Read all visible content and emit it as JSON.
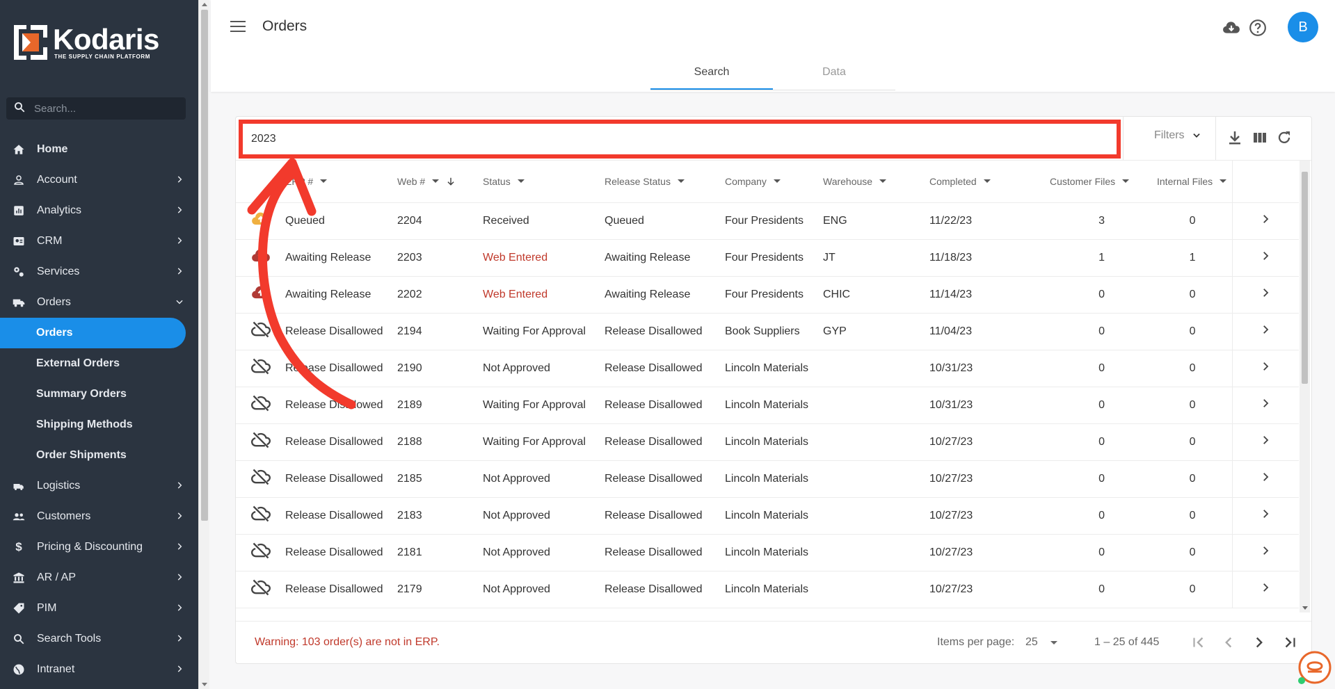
{
  "sidebar": {
    "logo": {
      "name": "Kodaris",
      "tagline": "THE SUPPLY CHAIN PLATFORM"
    },
    "search_placeholder": "Search...",
    "items": [
      {
        "label": "Home",
        "icon": "home-icon",
        "expandable": false
      },
      {
        "label": "Account",
        "icon": "person-icon",
        "expandable": true
      },
      {
        "label": "Analytics",
        "icon": "analytics-icon",
        "expandable": true
      },
      {
        "label": "CRM",
        "icon": "contact-card-icon",
        "expandable": true
      },
      {
        "label": "Services",
        "icon": "services-icon",
        "expandable": true
      },
      {
        "label": "Orders",
        "icon": "truck-icon",
        "expandable": true,
        "expanded": true
      },
      {
        "label": "Logistics",
        "icon": "shipping-icon",
        "expandable": true
      },
      {
        "label": "Customers",
        "icon": "group-icon",
        "expandable": true
      },
      {
        "label": "Pricing & Discounting",
        "icon": "dollar-icon",
        "expandable": true
      },
      {
        "label": "AR / AP",
        "icon": "bank-icon",
        "expandable": true
      },
      {
        "label": "PIM",
        "icon": "tag-icon",
        "expandable": true
      },
      {
        "label": "Search Tools",
        "icon": "search-icon",
        "expandable": true
      },
      {
        "label": "Intranet",
        "icon": "globe-icon",
        "expandable": true
      }
    ],
    "orders_subitems": [
      {
        "label": "Orders",
        "active": true
      },
      {
        "label": "External Orders",
        "active": false
      },
      {
        "label": "Summary Orders",
        "active": false
      },
      {
        "label": "Shipping Methods",
        "active": false
      },
      {
        "label": "Order Shipments",
        "active": false
      }
    ]
  },
  "header": {
    "title": "Orders",
    "avatar_initial": "B",
    "tabs": [
      {
        "label": "Search",
        "active": true
      },
      {
        "label": "Data",
        "active": false
      }
    ]
  },
  "toolbar": {
    "search_value": "2023",
    "filters_label": "Filters"
  },
  "table": {
    "columns": [
      "ERP #",
      "Web #",
      "Status",
      "Release Status",
      "Company",
      "Warehouse",
      "Completed",
      "Customer Files",
      "Internal Files"
    ],
    "rows": [
      {
        "icon": "cloud-upload-icon",
        "icon_color": "#f0b040",
        "erp": "Queued",
        "web": "2204",
        "status": "Received",
        "status_red": false,
        "release": "Queued",
        "company": "Four Presidents",
        "warehouse": "ENG",
        "completed": "11/22/23",
        "cust_files": "3",
        "int_files": "0"
      },
      {
        "icon": "cloud-upload-icon",
        "icon_color": "#b03a35",
        "erp": "Awaiting Release",
        "web": "2203",
        "status": "Web Entered",
        "status_red": true,
        "release": "Awaiting Release",
        "company": "Four Presidents",
        "warehouse": "JT",
        "completed": "11/18/23",
        "cust_files": "1",
        "int_files": "1"
      },
      {
        "icon": "cloud-upload-icon",
        "icon_color": "#b03a35",
        "erp": "Awaiting Release",
        "web": "2202",
        "status": "Web Entered",
        "status_red": true,
        "release": "Awaiting Release",
        "company": "Four Presidents",
        "warehouse": "CHIC",
        "completed": "11/14/23",
        "cust_files": "0",
        "int_files": "0"
      },
      {
        "icon": "cloud-off-icon",
        "icon_color": "#444",
        "erp": "Release Disallowed",
        "web": "2194",
        "status": "Waiting For Approval",
        "status_red": false,
        "release": "Release Disallowed",
        "company": "Book Suppliers",
        "warehouse": "GYP",
        "completed": "11/04/23",
        "cust_files": "0",
        "int_files": "0"
      },
      {
        "icon": "cloud-off-icon",
        "icon_color": "#444",
        "erp": "Release Disallowed",
        "web": "2190",
        "status": "Not Approved",
        "status_red": false,
        "release": "Release Disallowed",
        "company": "Lincoln Materials",
        "warehouse": "",
        "completed": "10/31/23",
        "cust_files": "0",
        "int_files": "0"
      },
      {
        "icon": "cloud-off-icon",
        "icon_color": "#444",
        "erp": "Release Disallowed",
        "web": "2189",
        "status": "Waiting For Approval",
        "status_red": false,
        "release": "Release Disallowed",
        "company": "Lincoln Materials",
        "warehouse": "",
        "completed": "10/31/23",
        "cust_files": "0",
        "int_files": "0"
      },
      {
        "icon": "cloud-off-icon",
        "icon_color": "#444",
        "erp": "Release Disallowed",
        "web": "2188",
        "status": "Waiting For Approval",
        "status_red": false,
        "release": "Release Disallowed",
        "company": "Lincoln Materials",
        "warehouse": "",
        "completed": "10/27/23",
        "cust_files": "0",
        "int_files": "0"
      },
      {
        "icon": "cloud-off-icon",
        "icon_color": "#444",
        "erp": "Release Disallowed",
        "web": "2185",
        "status": "Not Approved",
        "status_red": false,
        "release": "Release Disallowed",
        "company": "Lincoln Materials",
        "warehouse": "",
        "completed": "10/27/23",
        "cust_files": "0",
        "int_files": "0"
      },
      {
        "icon": "cloud-off-icon",
        "icon_color": "#444",
        "erp": "Release Disallowed",
        "web": "2183",
        "status": "Not Approved",
        "status_red": false,
        "release": "Release Disallowed",
        "company": "Lincoln Materials",
        "warehouse": "",
        "completed": "10/27/23",
        "cust_files": "0",
        "int_files": "0"
      },
      {
        "icon": "cloud-off-icon",
        "icon_color": "#444",
        "erp": "Release Disallowed",
        "web": "2181",
        "status": "Not Approved",
        "status_red": false,
        "release": "Release Disallowed",
        "company": "Lincoln Materials",
        "warehouse": "",
        "completed": "10/27/23",
        "cust_files": "0",
        "int_files": "0"
      },
      {
        "icon": "cloud-off-icon",
        "icon_color": "#444",
        "erp": "Release Disallowed",
        "web": "2179",
        "status": "Not Approved",
        "status_red": false,
        "release": "Release Disallowed",
        "company": "Lincoln Materials",
        "warehouse": "",
        "completed": "10/27/23",
        "cust_files": "0",
        "int_files": "0"
      }
    ]
  },
  "footer": {
    "warning": "Warning: 103 order(s) are not in ERP.",
    "items_per_page_label": "Items per page:",
    "items_per_page_value": "25",
    "range": "1 – 25 of 445"
  },
  "colors": {
    "accent": "#1a8ee8",
    "sidebar_bg": "#2b3440",
    "warning_red": "#c0392b",
    "highlight_red": "#f23a2c"
  }
}
